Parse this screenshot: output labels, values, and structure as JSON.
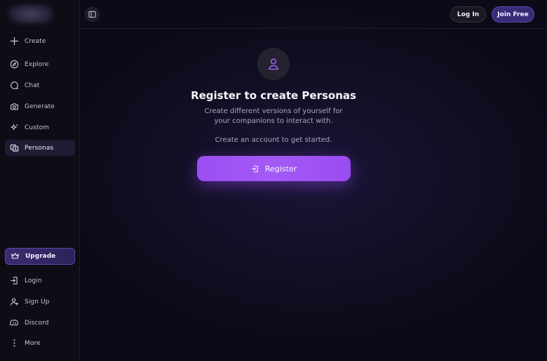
{
  "colors": {
    "accent": "#a052f4",
    "upgrade": "#3b2a72",
    "join": "#3a2b78"
  },
  "sidebar": {
    "items": [
      {
        "label": "Create",
        "icon": "plus-icon"
      },
      {
        "label": "Explore",
        "icon": "compass-icon"
      },
      {
        "label": "Chat",
        "icon": "chat-bubble-icon"
      },
      {
        "label": "Generate",
        "icon": "camera-icon"
      },
      {
        "label": "Custom",
        "icon": "sparkles-icon"
      },
      {
        "label": "Personas",
        "icon": "personas-icon",
        "active": true
      }
    ],
    "upgrade_label": "Upgrade",
    "bottom_items": [
      {
        "label": "Login",
        "icon": "login-icon"
      },
      {
        "label": "Sign Up",
        "icon": "user-plus-icon"
      },
      {
        "label": "Discord",
        "icon": "discord-icon"
      },
      {
        "label": "More",
        "icon": "more-vertical-icon"
      }
    ]
  },
  "header": {
    "login_label": "Log In",
    "join_label": "Join Free"
  },
  "main": {
    "title": "Register to create Personas",
    "subtitle": "Create different versions of yourself for your companions to interact with.",
    "cta_text": "Create an account to get started.",
    "register_label": "Register"
  }
}
